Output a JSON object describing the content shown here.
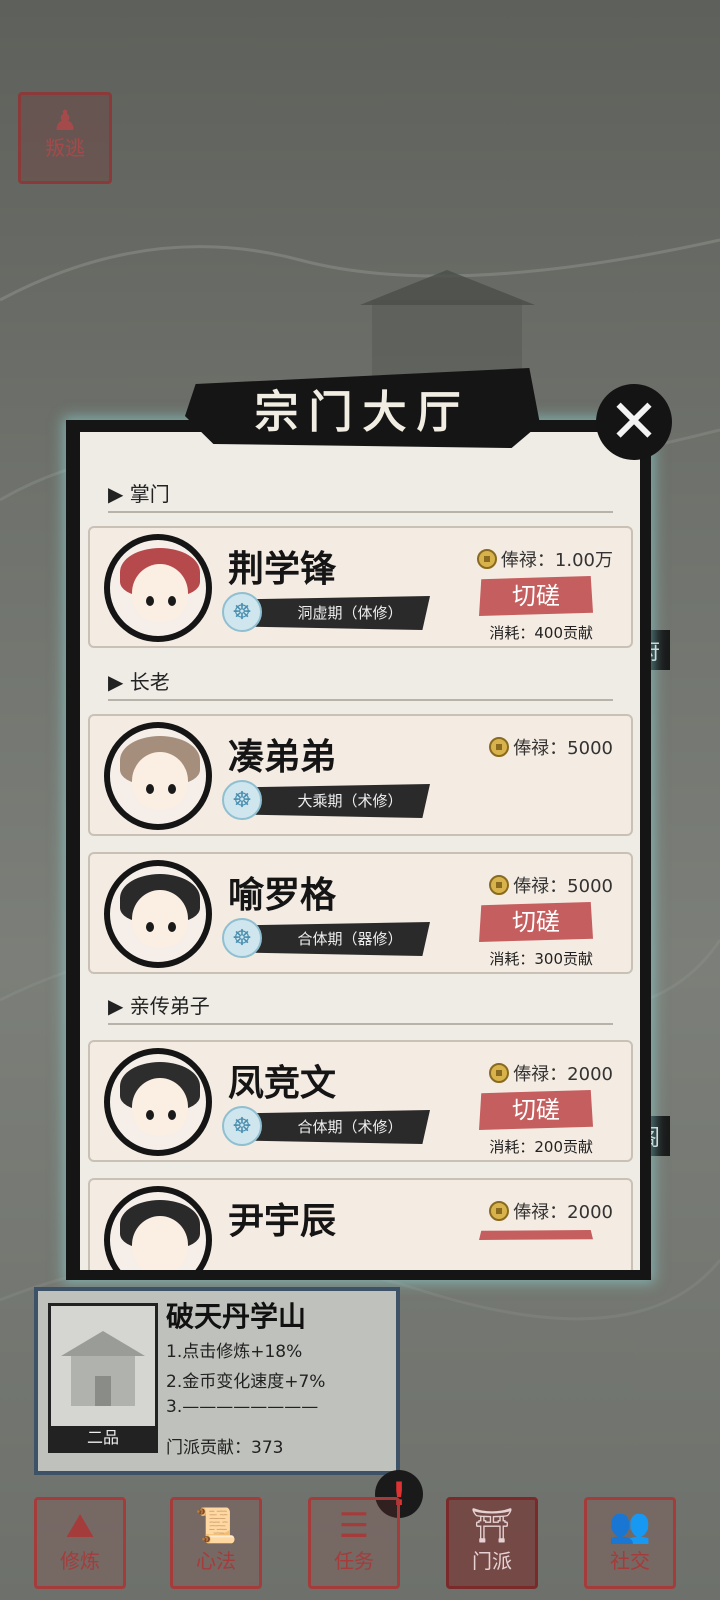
{
  "top_button": {
    "label": "叛逃",
    "icon": "figure-icon"
  },
  "side_tags": [
    "府",
    "阁"
  ],
  "panel": {
    "title": "宗门大厅",
    "sections": {
      "leader": "▶ 掌门",
      "elders": "▶ 长老",
      "disciples": "▶ 亲传弟子"
    },
    "members": [
      {
        "name": "荆学锋",
        "realm": "洞虚期（体修）",
        "salary": "俸禄：1.00万",
        "spar": "切磋",
        "cost": "消耗：400贡献"
      },
      {
        "name": "凑弟弟",
        "realm": "大乘期（术修）",
        "salary": "俸禄：5000"
      },
      {
        "name": "喻罗格",
        "realm": "合体期（器修）",
        "salary": "俸禄：5000",
        "spar": "切磋",
        "cost": "消耗：300贡献"
      },
      {
        "name": "凤竞文",
        "realm": "合体期（术修）",
        "salary": "俸禄：2000",
        "spar": "切磋",
        "cost": "消耗：200贡献"
      },
      {
        "name": "尹宇辰",
        "salary": "俸禄：2000"
      }
    ]
  },
  "info": {
    "title": "破天丹学山",
    "grade": "二品",
    "lines": [
      "1.点击修炼+18%",
      "2.金币变化速度+7%",
      "3.————————"
    ],
    "contribution": "门派贡献：373"
  },
  "nav": [
    {
      "label": "修炼",
      "icon": "cultivate-icon"
    },
    {
      "label": "心法",
      "icon": "scroll-icon"
    },
    {
      "label": "任务",
      "icon": "task-icon"
    },
    {
      "label": "门派",
      "icon": "sect-icon",
      "active": true
    },
    {
      "label": "社交",
      "icon": "social-icon"
    }
  ],
  "colors": {
    "accent_red": "#c55e5e",
    "panel_bg": "#efece6",
    "glow": "#8cdcdc"
  }
}
